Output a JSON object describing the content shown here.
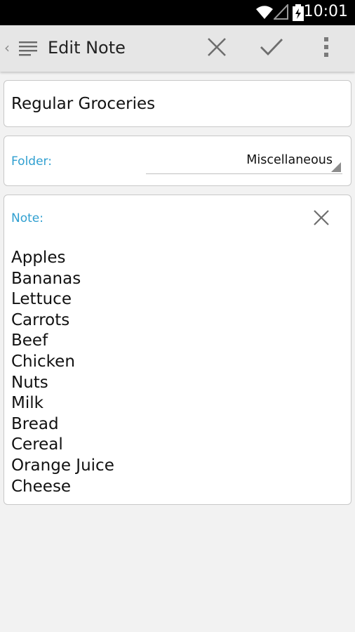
{
  "status_bar": {
    "time": "10:01",
    "icons": [
      "wifi-icon",
      "signal-icon",
      "battery-charging-icon"
    ]
  },
  "action_bar": {
    "title": "Edit Note",
    "icons": {
      "up": "chevron-left-icon",
      "app": "notes-lines-icon",
      "cancel": "close-icon",
      "save": "check-icon",
      "overflow": "overflow-menu-icon"
    }
  },
  "form": {
    "note_title": "Regular Groceries",
    "folder_label": "Folder:",
    "folder_value": "Miscellaneous",
    "note_label": "Note:",
    "note_text": "Apples\nBananas\nLettuce\nCarrots\nBeef\nChicken\nNuts\nMilk\nBread\nCereal\nOrange Juice\nCheese"
  },
  "colors": {
    "accent_label": "#2f9fd0",
    "action_bar_bg": "#e6e6e6",
    "background": "#f2f2f2",
    "icon_gray": "#7a7a7a"
  }
}
